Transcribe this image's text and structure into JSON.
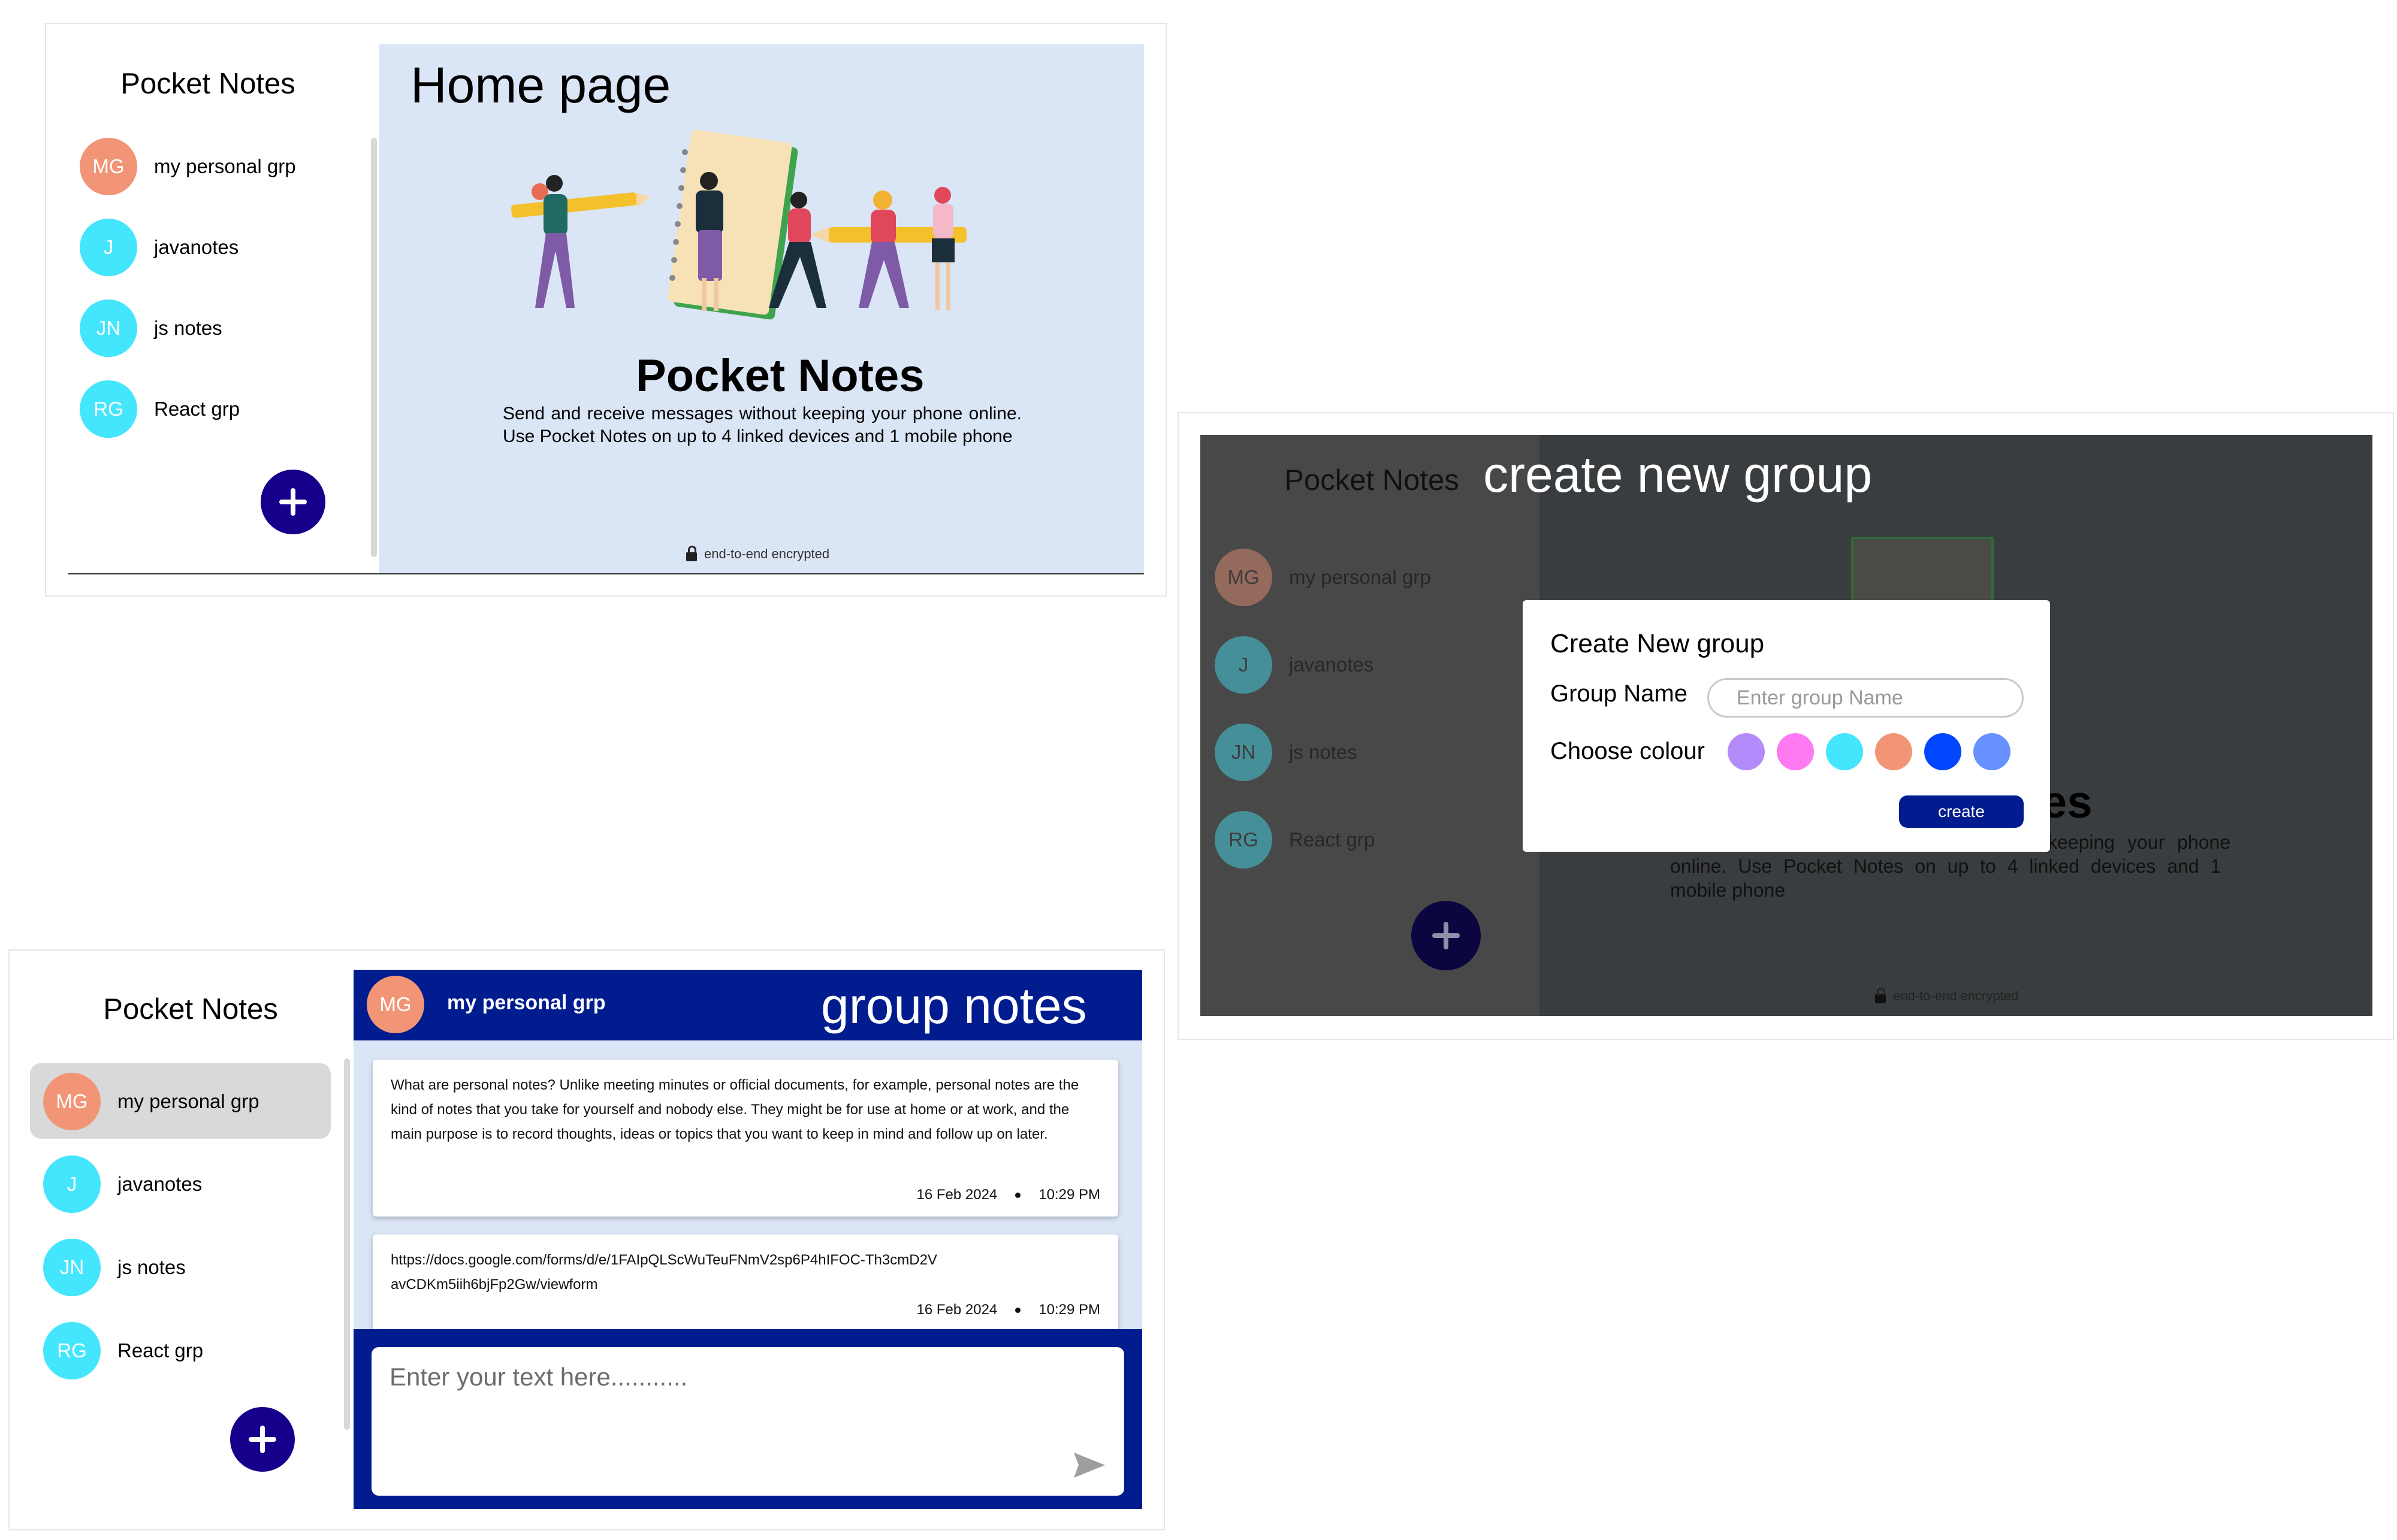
{
  "home_page": {
    "tag": "Home page",
    "sidebar": {
      "title": "Pocket Notes",
      "groups": [
        {
          "initials": "MG",
          "name": "my personal grp",
          "color": "#f19576"
        },
        {
          "initials": "J",
          "name": "javanotes",
          "color": "#43e6fc"
        },
        {
          "initials": "JN",
          "name": "js notes",
          "color": "#43e6fc"
        },
        {
          "initials": "RG",
          "name": "React grp",
          "color": "#43e6fc"
        }
      ]
    },
    "main": {
      "title": "Pocket Notes",
      "description": "Send and receive messages without keeping your phone online. Use Pocket Notes on up to 4 linked devices and 1 mobile phone",
      "encryption_note": "end-to-end encrypted"
    }
  },
  "create_group": {
    "tag": "create new group",
    "sidebar": {
      "title": "Pocket Notes",
      "groups": [
        {
          "initials": "MG",
          "name": "my personal grp"
        },
        {
          "initials": "J",
          "name": "javanotes"
        },
        {
          "initials": "JN",
          "name": "js notes"
        },
        {
          "initials": "RG",
          "name": "React grp"
        }
      ]
    },
    "background": {
      "title_fragment": "es",
      "description_fragment_1": "keeping your phone",
      "description_fragment_2": "online. Use Pocket Notes on up to 4 linked devices and 1",
      "description_fragment_3": "mobile phone",
      "encryption_note": "end-to-end encrypted"
    },
    "modal": {
      "title": "Create New group",
      "name_label": "Group Name",
      "name_placeholder": "Enter group Name",
      "colour_label": "Choose colour",
      "colours": [
        "#b38bfa",
        "#ff79f2",
        "#43e6fc",
        "#f19576",
        "#0047ff",
        "#6691ff"
      ],
      "create_label": "create"
    }
  },
  "group_notes": {
    "tag": "group notes",
    "sidebar": {
      "title": "Pocket Notes",
      "groups": [
        {
          "initials": "MG",
          "name": "my personal grp",
          "color": "#f19576",
          "selected": true
        },
        {
          "initials": "J",
          "name": "javanotes",
          "color": "#43e6fc"
        },
        {
          "initials": "JN",
          "name": "js notes",
          "color": "#43e6fc"
        },
        {
          "initials": "RG",
          "name": "React grp",
          "color": "#43e6fc"
        }
      ]
    },
    "header": {
      "initials": "MG",
      "name": "my personal grp",
      "color": "#f19576"
    },
    "notes": [
      {
        "text": "What are personal notes? Unlike meeting minutes or official documents, for example, personal notes are the kind of notes that you take for yourself and nobody else. They might be for use at home or at work, and the main purpose is to record thoughts, ideas or topics that you want to keep in mind and follow up on later.",
        "date": "16 Feb 2024",
        "time": "10:29 PM"
      },
      {
        "text": "https://docs.google.com/forms/d/e/1FAIpQLScWuTeuFNmV2sp6P4hIFOC-Th3cmD2VavCDKm5iih6bjFp2Gw/viewform",
        "date": "16 Feb 2024",
        "time": "10:29 PM"
      }
    ],
    "input": {
      "placeholder": "Enter your text here..........."
    }
  }
}
